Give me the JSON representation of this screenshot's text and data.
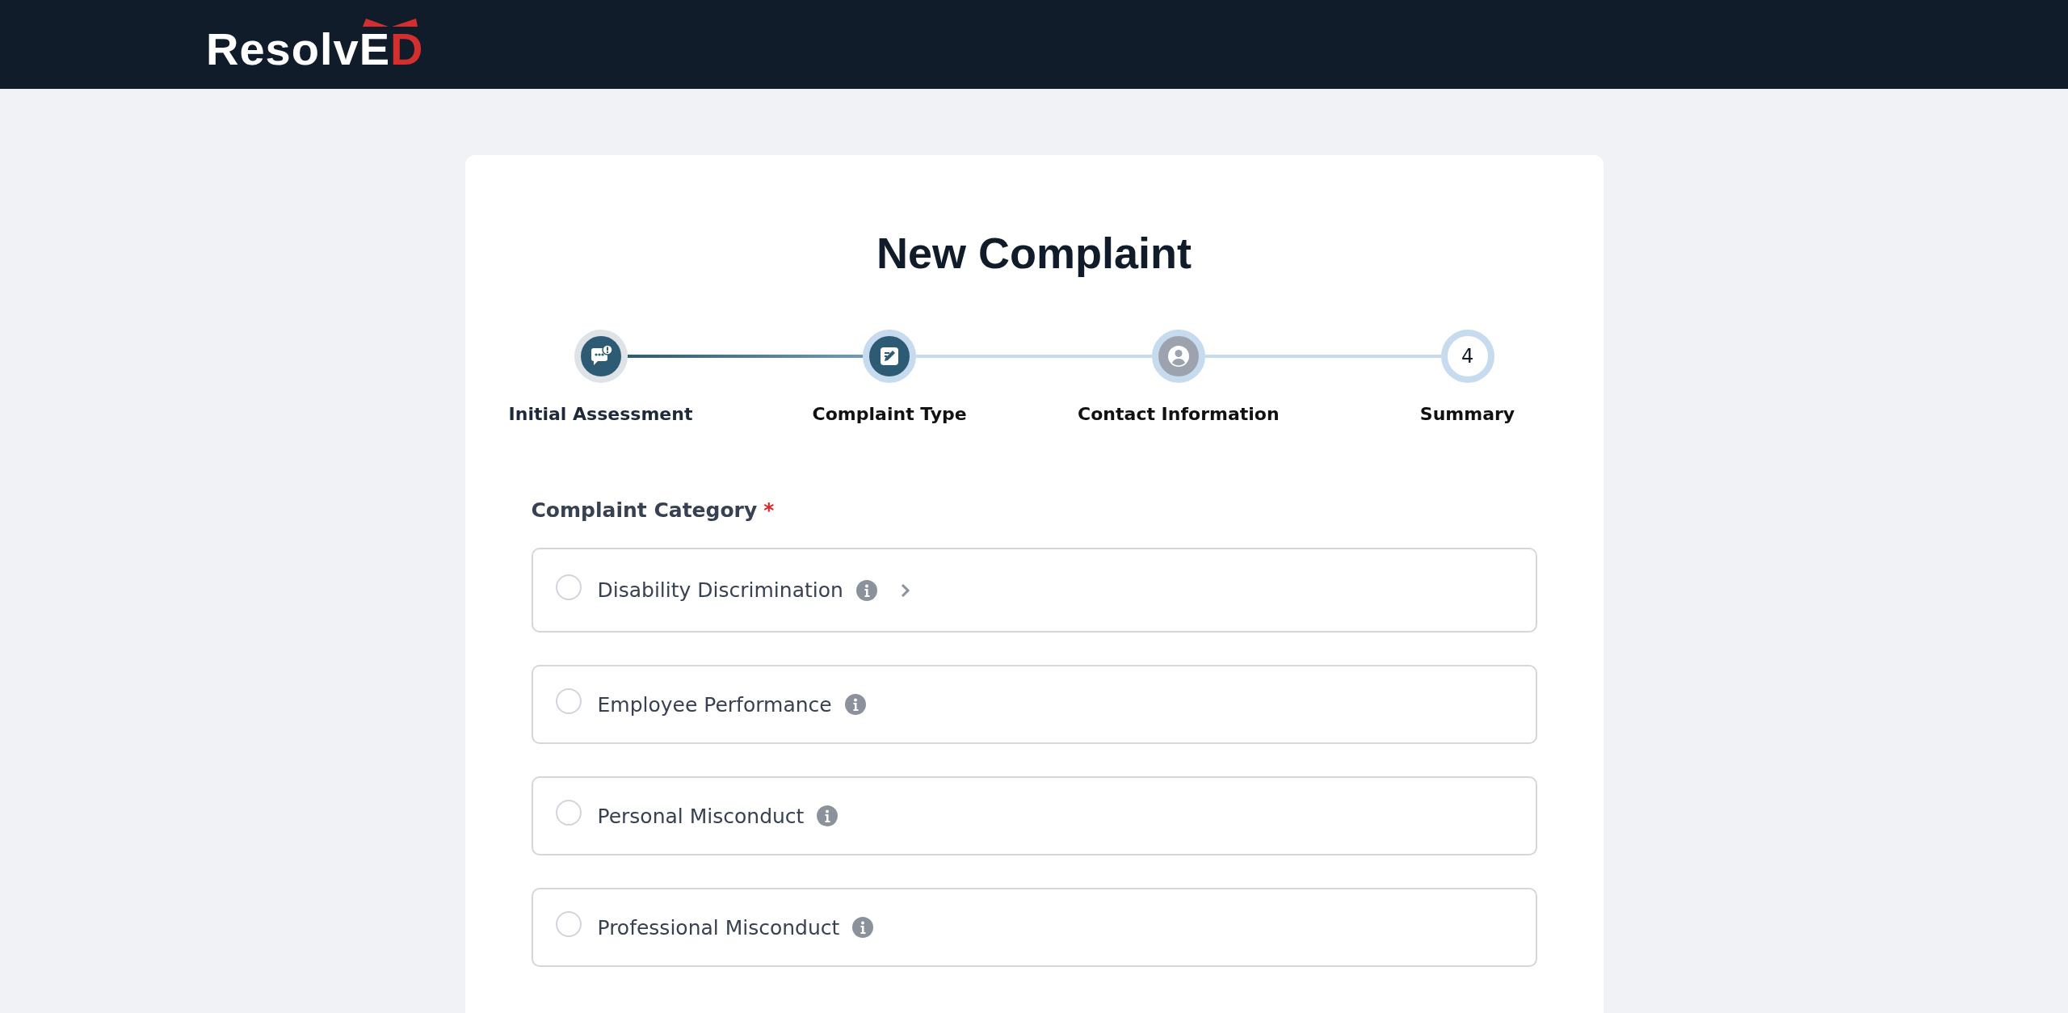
{
  "header": {
    "logo": {
      "main": "Resolv",
      "book_left": "E",
      "book_right": "D"
    }
  },
  "form": {
    "title": "New Complaint",
    "steps": [
      {
        "label": "Initial Assessment",
        "kind": "chat",
        "current": true,
        "disabled": false
      },
      {
        "label": "Complaint Type",
        "kind": "edit",
        "current": false,
        "disabled": false
      },
      {
        "label": "Contact Information",
        "kind": "person",
        "current": false,
        "disabled": true
      },
      {
        "label": "Summary",
        "kind": "number",
        "number": "4",
        "current": false,
        "disabled": false
      }
    ],
    "category": {
      "label": "Complaint Category",
      "required_mark": "*",
      "options": [
        {
          "label": "Disability Discrimination",
          "selected": false,
          "expandable": true
        },
        {
          "label": "Employee Performance",
          "selected": false,
          "expandable": false
        },
        {
          "label": "Personal Misconduct",
          "selected": false,
          "expandable": false
        },
        {
          "label": "Professional Misconduct",
          "selected": false,
          "expandable": false
        }
      ]
    }
  }
}
